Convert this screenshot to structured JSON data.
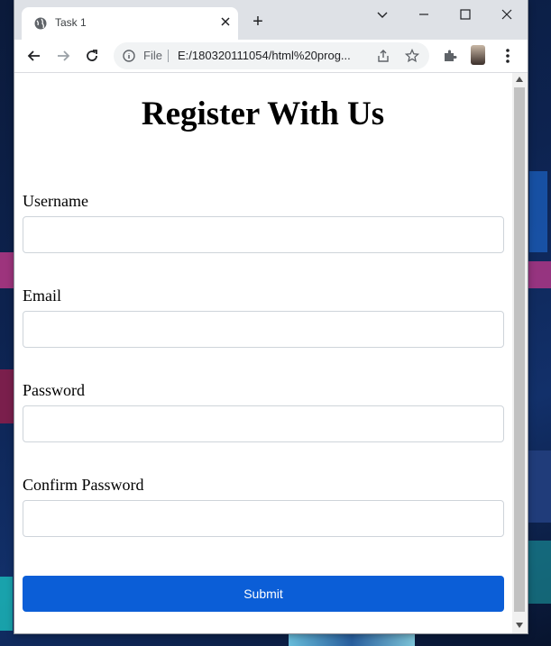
{
  "browser": {
    "tab_title": "Task 1",
    "new_tab_label": "+",
    "omnibox_scheme": "File",
    "url": "E:/180320111054/html%20prog..."
  },
  "page": {
    "heading": "Register With Us",
    "fields": [
      {
        "label": "Username",
        "value": "",
        "placeholder": ""
      },
      {
        "label": "Email",
        "value": "",
        "placeholder": ""
      },
      {
        "label": "Password",
        "value": "",
        "placeholder": ""
      },
      {
        "label": "Confirm Password",
        "value": "",
        "placeholder": ""
      }
    ],
    "submit_label": "Submit"
  },
  "colors": {
    "accent": "#0b5ed7",
    "tabstrip": "#dee1e6"
  }
}
